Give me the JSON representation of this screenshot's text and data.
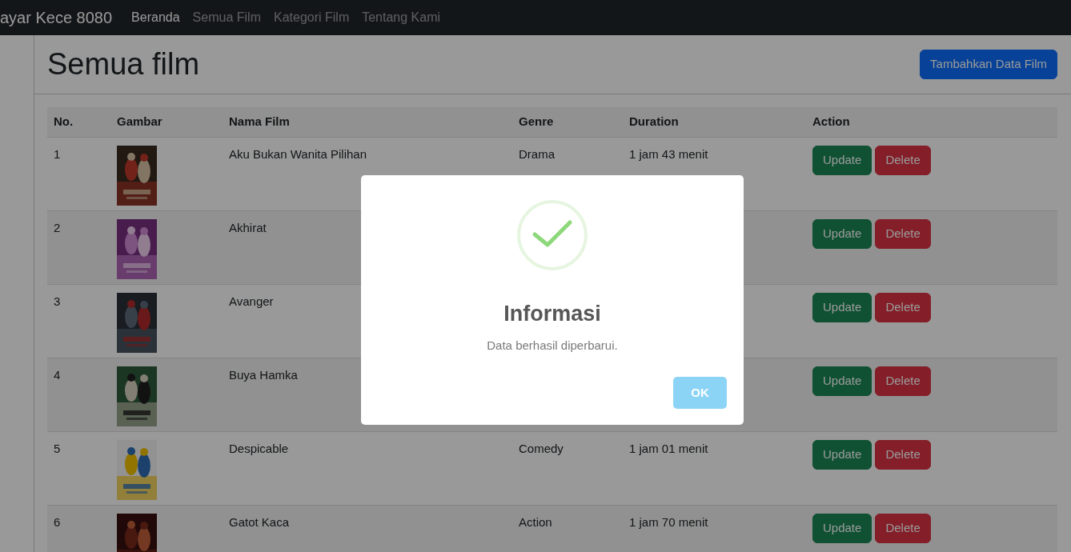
{
  "navbar": {
    "brand": "ayar Kece 8080",
    "links": [
      {
        "label": "Beranda",
        "selected": true
      },
      {
        "label": "Semua Film",
        "selected": false
      },
      {
        "label": "Kategori Film",
        "selected": false
      },
      {
        "label": "Tentang Kami",
        "selected": false
      }
    ]
  },
  "page": {
    "title": "Semua film",
    "add_button": "Tambahkan Data Film"
  },
  "table": {
    "columns": [
      "No.",
      "Gambar",
      "Nama Film",
      "Genre",
      "Duration",
      "Action"
    ],
    "rows": [
      {
        "no": "1",
        "name": "Aku Bukan Wanita Pilihan",
        "genre": "Drama",
        "duration": "1 jam 43 menit",
        "actions": [
          "Update",
          "Delete"
        ]
      },
      {
        "no": "2",
        "name": "Akhirat",
        "actions": [
          "Update",
          "Delete"
        ]
      },
      {
        "no": "3",
        "name": "Avanger",
        "actions": [
          "Update",
          "Delete"
        ]
      },
      {
        "no": "4",
        "name": "Buya Hamka",
        "actions": [
          "Update",
          "Delete"
        ]
      },
      {
        "no": "5",
        "name": "Despicable",
        "genre": "Comedy",
        "duration": "1 jam 01 menit",
        "actions": [
          "Update",
          "Delete"
        ]
      },
      {
        "no": "6",
        "name": "Gatot Kaca",
        "genre": "Action",
        "duration": "1 jam 70 menit",
        "actions": [
          "Update",
          "Delete"
        ]
      }
    ]
  },
  "dialog": {
    "title": "Informasi",
    "message": "Data berhasil diperbarui.",
    "button": "OK"
  }
}
